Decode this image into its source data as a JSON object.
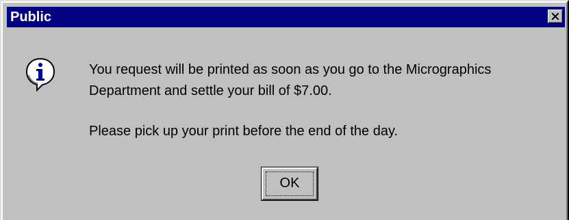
{
  "window": {
    "title": "Public"
  },
  "icons": {
    "close": "close-icon",
    "info": "information-icon"
  },
  "message": {
    "line1": "You request will be printed as soon as you go to the Micrographics Department and settle your bill of $7.00.",
    "line2": "Please pick up your print before the end of the day."
  },
  "buttons": {
    "ok_label": "OK"
  },
  "colors": {
    "titlebar": "#000080",
    "dialog_face": "#c0c0c0",
    "title_text": "#ffffff"
  }
}
